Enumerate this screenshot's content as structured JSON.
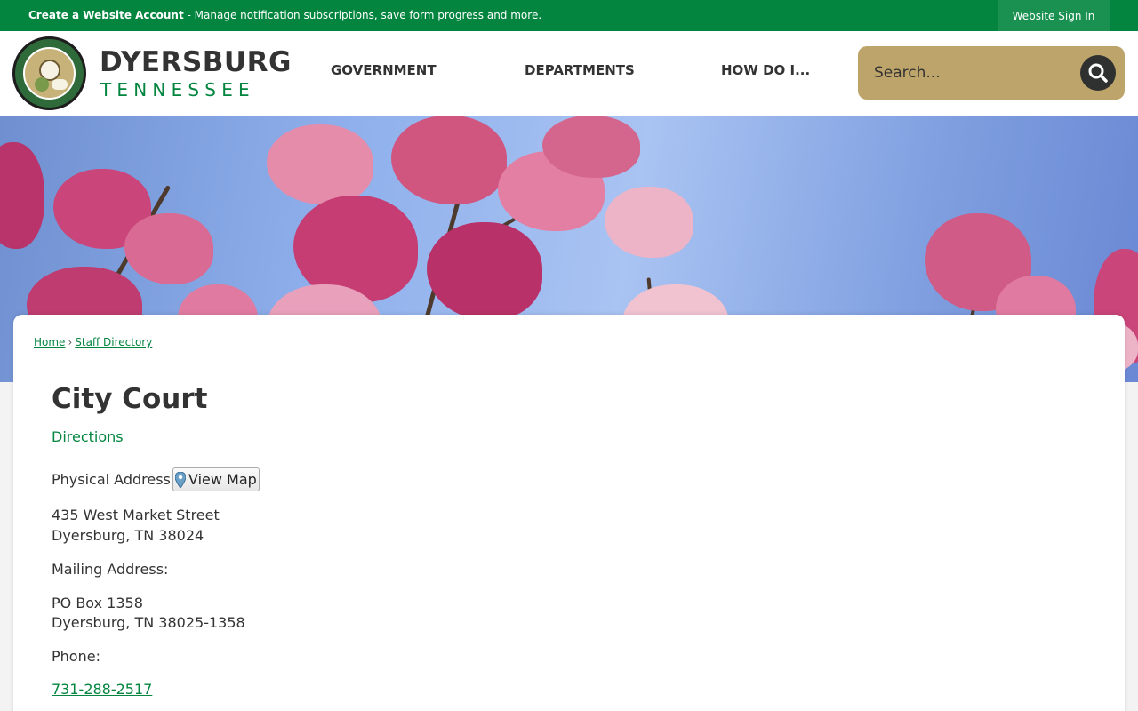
{
  "topbar": {
    "create_account": "Create a Website Account",
    "message": " - Manage notification subscriptions, save form progress and more.",
    "sign_in": "Website Sign In"
  },
  "header": {
    "brand_title": "DYERSBURG",
    "brand_subtitle": "TENNESSEE",
    "nav": [
      "GOVERNMENT",
      "DEPARTMENTS",
      "HOW DO I..."
    ],
    "search_placeholder": "Search..."
  },
  "breadcrumb": {
    "home": "Home",
    "separator": "›",
    "current": "Staff Directory"
  },
  "content": {
    "title": "City Court",
    "directions": "Directions",
    "physical_label": "Physical Address:",
    "view_map": "View Map",
    "physical_line1": "435 West Market Street",
    "physical_line2": "Dyersburg, TN 38024",
    "mailing_label": "Mailing Address:",
    "mailing_line1": "PO Box 1358",
    "mailing_line2": "Dyersburg, TN 38025-1358",
    "phone_label": "Phone:",
    "phone": "731-288-2517"
  },
  "colors": {
    "brand_green": "#03853f",
    "search_gold": "#bda46a",
    "text_dark": "#333333"
  }
}
